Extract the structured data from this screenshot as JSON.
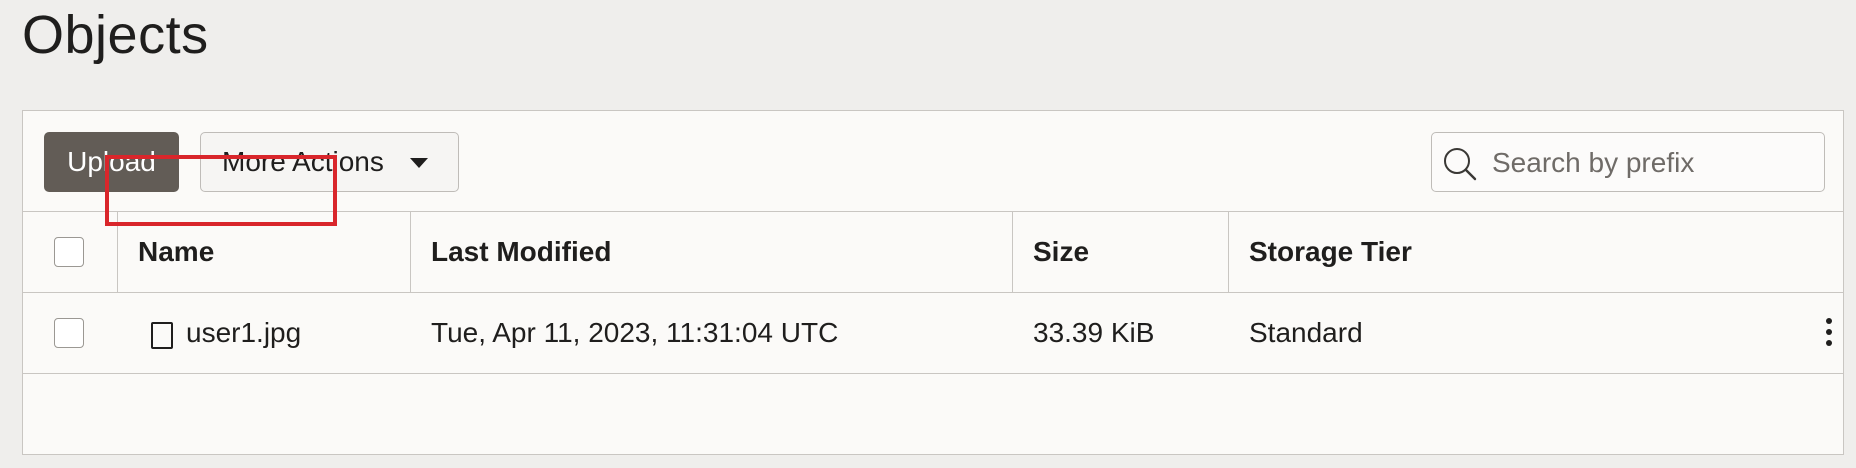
{
  "page": {
    "title": "Objects"
  },
  "toolbar": {
    "upload_label": "Upload",
    "more_actions_label": "More Actions"
  },
  "search": {
    "placeholder": "Search by prefix",
    "value": ""
  },
  "table": {
    "columns": [
      "Name",
      "Last Modified",
      "Size",
      "Storage Tier"
    ],
    "rows": [
      {
        "name": "user1.jpg",
        "last_modified": "Tue, Apr 11, 2023, 11:31:04 UTC",
        "size": "33.39 KiB",
        "storage_tier": "Standard"
      }
    ]
  },
  "icons": {
    "search": "search-icon",
    "caret": "caret-down-icon",
    "file": "file-icon",
    "row_actions": "kebab-menu-icon"
  },
  "colors": {
    "upload_button": "#625c56",
    "highlight": "#d9262b",
    "border": "#c9c6c2"
  }
}
